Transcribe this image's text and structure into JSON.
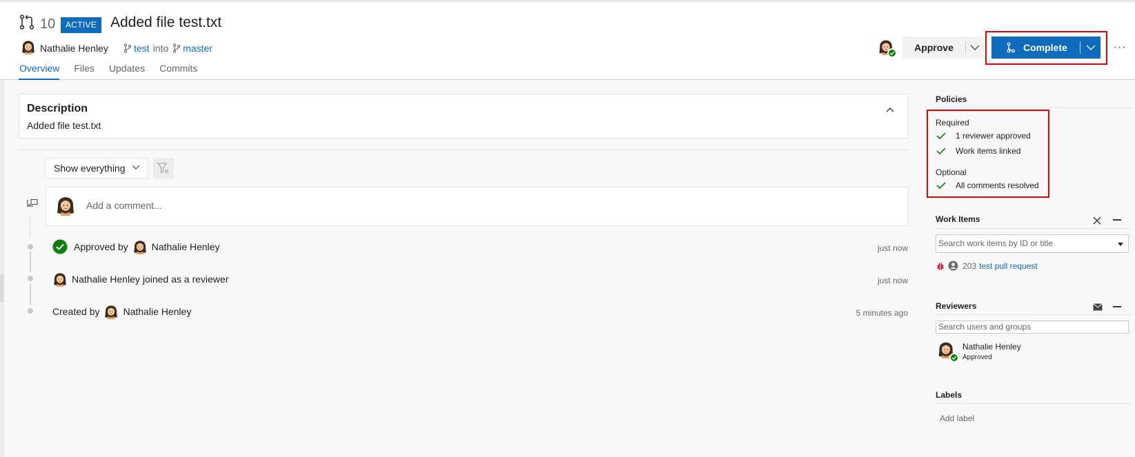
{
  "header": {
    "pr_number": "10",
    "status_badge": "ACTIVE",
    "title": "Added file test.txt",
    "author": "Nathalie Henley",
    "source_branch": "test",
    "into_word": "into",
    "target_branch": "master",
    "tabs": [
      {
        "label": "Overview",
        "active": true
      },
      {
        "label": "Files",
        "active": false
      },
      {
        "label": "Updates",
        "active": false
      },
      {
        "label": "Commits",
        "active": false
      }
    ],
    "approve_label": "Approve",
    "complete_label": "Complete",
    "more_label": "···"
  },
  "description": {
    "heading": "Description",
    "text": "Added file test.txt"
  },
  "activity": {
    "filter_label": "Show everything",
    "comment_placeholder": "Add a comment...",
    "events": [
      {
        "text_before": "Approved by",
        "name": "Nathalie Henley",
        "text_after": "",
        "time": "just now"
      },
      {
        "text_before": "",
        "name": "Nathalie Henley",
        "text_after": "joined as a reviewer",
        "time": "just now"
      },
      {
        "text_before": "Created by",
        "name": "Nathalie Henley",
        "text_after": "",
        "time": "5 minutes ago"
      }
    ]
  },
  "sidebar": {
    "policies": {
      "heading": "Policies",
      "required_label": "Required",
      "required_items": [
        "1 reviewer approved",
        "Work items linked"
      ],
      "optional_label": "Optional",
      "optional_items": [
        "All comments resolved"
      ]
    },
    "work_items": {
      "heading": "Work Items",
      "search_placeholder": "Search work items by ID or title",
      "item_id": "203",
      "item_title": "test pull request"
    },
    "reviewers": {
      "heading": "Reviewers",
      "search_placeholder": "Search users and groups",
      "name": "Nathalie Henley",
      "status": "Approved"
    },
    "labels": {
      "heading": "Labels",
      "add_label": "Add label"
    }
  },
  "colors": {
    "accent": "#0f6cbd",
    "success": "#107c10",
    "highlight": "#e50000"
  },
  "icons": [
    "pull-request-icon",
    "branch-icon",
    "chevron-down-icon",
    "chevron-up-icon",
    "merge-icon",
    "filter-clear-icon",
    "comment-icon",
    "check-icon",
    "close-icon",
    "mail-icon",
    "bug-icon",
    "avatar"
  ]
}
